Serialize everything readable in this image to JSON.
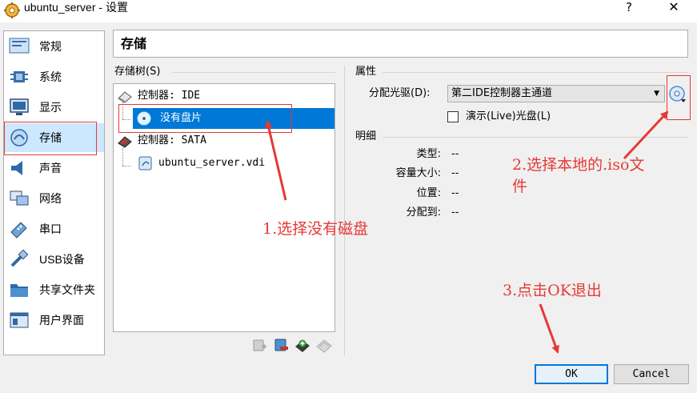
{
  "window": {
    "title": "ubuntu_server - 设置",
    "help_label": "?",
    "close_label": "✕"
  },
  "sidebar": {
    "items": [
      {
        "label": "常规",
        "icon": "general-icon"
      },
      {
        "label": "系统",
        "icon": "system-icon"
      },
      {
        "label": "显示",
        "icon": "display-icon"
      },
      {
        "label": "存储",
        "icon": "storage-icon",
        "selected": true
      },
      {
        "label": "声音",
        "icon": "audio-icon"
      },
      {
        "label": "网络",
        "icon": "network-icon"
      },
      {
        "label": "串口",
        "icon": "serial-port-icon"
      },
      {
        "label": "USB设备",
        "icon": "usb-icon"
      },
      {
        "label": "共享文件夹",
        "icon": "shared-folder-icon"
      },
      {
        "label": "用户界面",
        "icon": "user-interface-icon"
      }
    ]
  },
  "page": {
    "title": "存储"
  },
  "storage_tree": {
    "label": "存储树(S)",
    "items": [
      {
        "label": "控制器: IDE",
        "icon": "ide-controller-icon"
      },
      {
        "label": "没有盘片",
        "icon": "optical-disc-icon",
        "selected": true
      },
      {
        "label": "控制器: SATA",
        "icon": "sata-controller-icon"
      },
      {
        "label": "ubuntu_server.vdi",
        "icon": "hard-disk-icon"
      }
    ],
    "tools": [
      "add-attachment-icon",
      "remove-attachment-icon",
      "add-controller-icon",
      "remove-controller-icon"
    ]
  },
  "properties": {
    "label": "属性",
    "drive_label": "分配光驱(D):",
    "drive_value": "第二IDE控制器主通道",
    "live_cd_label": "演示(Live)光盘(L)",
    "live_cd_checked": false
  },
  "info": {
    "label": "明细",
    "rows": [
      {
        "label": "类型:",
        "value": "--"
      },
      {
        "label": "容量大小:",
        "value": "--"
      },
      {
        "label": "位置:",
        "value": "--"
      },
      {
        "label": "分配到:",
        "value": "--"
      }
    ]
  },
  "buttons": {
    "ok": "OK",
    "cancel": "Cancel"
  },
  "annotations": {
    "step1": "1.选择没有磁盘",
    "step2_line1": "2.选择本地的.iso文",
    "step2_line2": "件",
    "step3": "3.点击OK退出"
  },
  "colors": {
    "annotation": "#e53935",
    "selection": "#0078d7",
    "sidebar_selection": "#cce8ff"
  }
}
